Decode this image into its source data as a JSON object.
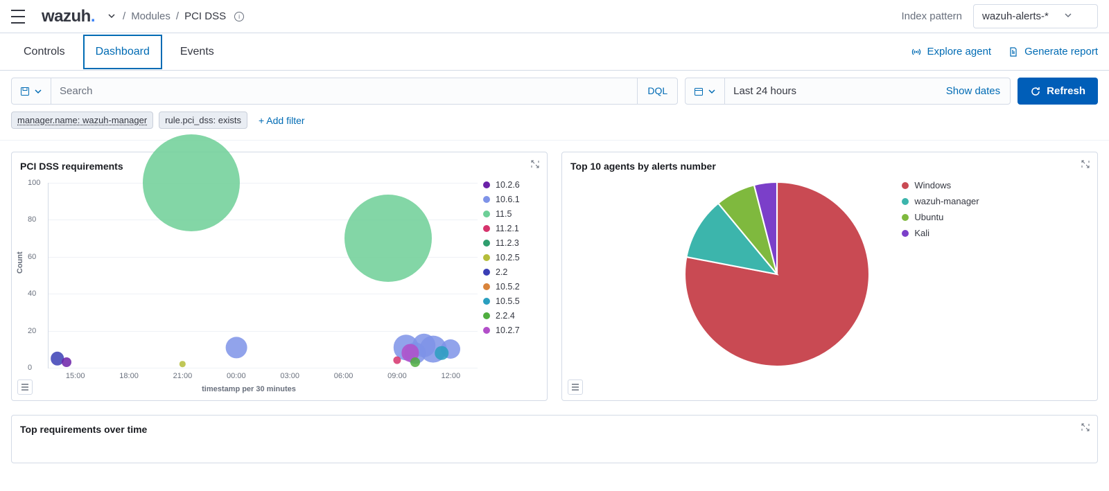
{
  "header": {
    "breadcrumb_modules": "Modules",
    "breadcrumb_current": "PCI DSS",
    "index_pattern_label": "Index pattern",
    "index_pattern_value": "wazuh-alerts-*"
  },
  "tabs": {
    "controls": "Controls",
    "dashboard": "Dashboard",
    "events": "Events",
    "explore_agent": "Explore agent",
    "generate_report": "Generate report"
  },
  "query": {
    "placeholder": "Search",
    "lang": "DQL",
    "date": "Last 24 hours",
    "show_dates": "Show dates",
    "refresh": "Refresh"
  },
  "filters": {
    "f0": "manager.name: wazuh-manager",
    "f1": "rule.pci_dss: exists",
    "add": "+ Add filter"
  },
  "panels": {
    "pci_title": "PCI DSS requirements",
    "agents_title": "Top 10 agents by alerts number",
    "top_req_title": "Top requirements over time"
  },
  "chart_data": [
    {
      "type": "scatter",
      "title": "PCI DSS requirements",
      "xlabel": "timestamp per 30 minutes",
      "ylabel": "Count",
      "ylim": [
        0,
        100
      ],
      "x_categories": [
        "15:00",
        "18:00",
        "21:00",
        "00:00",
        "03:00",
        "06:00",
        "09:00",
        "12:00"
      ],
      "series": [
        {
          "name": "10.2.6",
          "color": "#6b21a8"
        },
        {
          "name": "10.6.1",
          "color": "#7e93e8"
        },
        {
          "name": "11.5",
          "color": "#6dcf97"
        },
        {
          "name": "11.2.1",
          "color": "#d6336c"
        },
        {
          "name": "11.2.3",
          "color": "#2f9e6e"
        },
        {
          "name": "10.2.5",
          "color": "#b5bd3a"
        },
        {
          "name": "2.2",
          "color": "#3b3fb5"
        },
        {
          "name": "10.5.2",
          "color": "#d9843b"
        },
        {
          "name": "10.5.5",
          "color": "#2a9fbf"
        },
        {
          "name": "2.2.4",
          "color": "#4fae3f"
        },
        {
          "name": "10.2.7",
          "color": "#b24fc9"
        }
      ],
      "points": [
        {
          "series": "11.5",
          "x": "21:30",
          "y": 100,
          "size": 100
        },
        {
          "series": "11.5",
          "x": "08:30",
          "y": 70,
          "size": 90
        },
        {
          "series": "10.6.1",
          "x": "00:00",
          "y": 11,
          "size": 22
        },
        {
          "series": "10.6.1",
          "x": "09:30",
          "y": 11,
          "size": 26
        },
        {
          "series": "10.6.1",
          "x": "10:00",
          "y": 8,
          "size": 22
        },
        {
          "series": "10.6.1",
          "x": "10:30",
          "y": 12,
          "size": 24
        },
        {
          "series": "10.6.1",
          "x": "11:00",
          "y": 10,
          "size": 28
        },
        {
          "series": "10.6.1",
          "x": "12:00",
          "y": 10,
          "size": 20
        },
        {
          "series": "2.2",
          "x": "14:00",
          "y": 5,
          "size": 14
        },
        {
          "series": "10.2.7",
          "x": "09:45",
          "y": 8,
          "size": 18
        },
        {
          "series": "10.2.6",
          "x": "14:30",
          "y": 3,
          "size": 10
        },
        {
          "series": "10.5.5",
          "x": "11:30",
          "y": 8,
          "size": 14
        },
        {
          "series": "2.2.4",
          "x": "10:00",
          "y": 3,
          "size": 10
        },
        {
          "series": "10.2.5",
          "x": "21:00",
          "y": 2,
          "size": 6
        },
        {
          "series": "11.2.1",
          "x": "09:00",
          "y": 4,
          "size": 8
        }
      ]
    },
    {
      "type": "pie",
      "title": "Top 10 agents by alerts number",
      "series": [
        {
          "name": "Windows",
          "value": 78,
          "color": "#c94a53"
        },
        {
          "name": "wazuh-manager",
          "value": 11,
          "color": "#3cb5ac"
        },
        {
          "name": "Ubuntu",
          "value": 7,
          "color": "#7fb93e"
        },
        {
          "name": "Kali",
          "value": 4,
          "color": "#7b3fc9"
        }
      ]
    }
  ]
}
